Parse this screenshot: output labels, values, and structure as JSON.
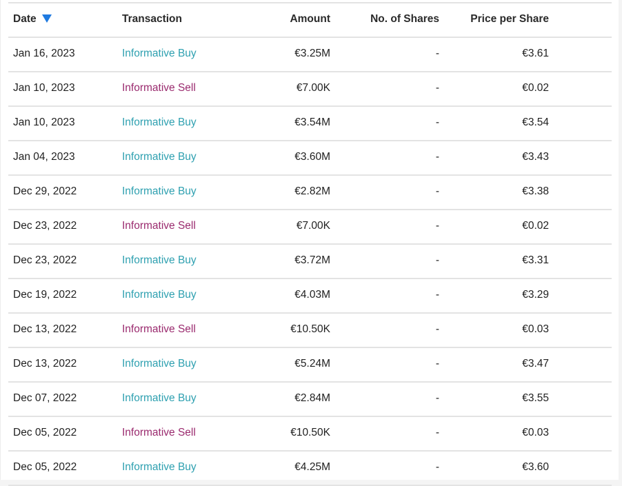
{
  "colors": {
    "buy": "#2ea0b0",
    "sell": "#9a2a6e",
    "sort_indicator": "#1f7ae0"
  },
  "table": {
    "headers": {
      "date": "Date",
      "transaction": "Transaction",
      "amount": "Amount",
      "shares": "No. of Shares",
      "price": "Price per Share"
    },
    "sort": {
      "column": "date",
      "direction": "descending",
      "icon": "triangle-down-icon"
    },
    "rows": [
      {
        "date": "Jan 16, 2023",
        "transaction": "Informative Buy",
        "type": "buy",
        "amount": "€3.25M",
        "shares": "-",
        "price": "€3.61"
      },
      {
        "date": "Jan 10, 2023",
        "transaction": "Informative Sell",
        "type": "sell",
        "amount": "€7.00K",
        "shares": "-",
        "price": "€0.02"
      },
      {
        "date": "Jan 10, 2023",
        "transaction": "Informative Buy",
        "type": "buy",
        "amount": "€3.54M",
        "shares": "-",
        "price": "€3.54"
      },
      {
        "date": "Jan 04, 2023",
        "transaction": "Informative Buy",
        "type": "buy",
        "amount": "€3.60M",
        "shares": "-",
        "price": "€3.43"
      },
      {
        "date": "Dec 29, 2022",
        "transaction": "Informative Buy",
        "type": "buy",
        "amount": "€2.82M",
        "shares": "-",
        "price": "€3.38"
      },
      {
        "date": "Dec 23, 2022",
        "transaction": "Informative Sell",
        "type": "sell",
        "amount": "€7.00K",
        "shares": "-",
        "price": "€0.02"
      },
      {
        "date": "Dec 23, 2022",
        "transaction": "Informative Buy",
        "type": "buy",
        "amount": "€3.72M",
        "shares": "-",
        "price": "€3.31"
      },
      {
        "date": "Dec 19, 2022",
        "transaction": "Informative Buy",
        "type": "buy",
        "amount": "€4.03M",
        "shares": "-",
        "price": "€3.29"
      },
      {
        "date": "Dec 13, 2022",
        "transaction": "Informative Sell",
        "type": "sell",
        "amount": "€10.50K",
        "shares": "-",
        "price": "€0.03"
      },
      {
        "date": "Dec 13, 2022",
        "transaction": "Informative Buy",
        "type": "buy",
        "amount": "€5.24M",
        "shares": "-",
        "price": "€3.47"
      },
      {
        "date": "Dec 07, 2022",
        "transaction": "Informative Buy",
        "type": "buy",
        "amount": "€2.84M",
        "shares": "-",
        "price": "€3.55"
      },
      {
        "date": "Dec 05, 2022",
        "transaction": "Informative Sell",
        "type": "sell",
        "amount": "€10.50K",
        "shares": "-",
        "price": "€0.03"
      },
      {
        "date": "Dec 05, 2022",
        "transaction": "Informative Buy",
        "type": "buy",
        "amount": "€4.25M",
        "shares": "-",
        "price": "€3.60"
      }
    ]
  }
}
